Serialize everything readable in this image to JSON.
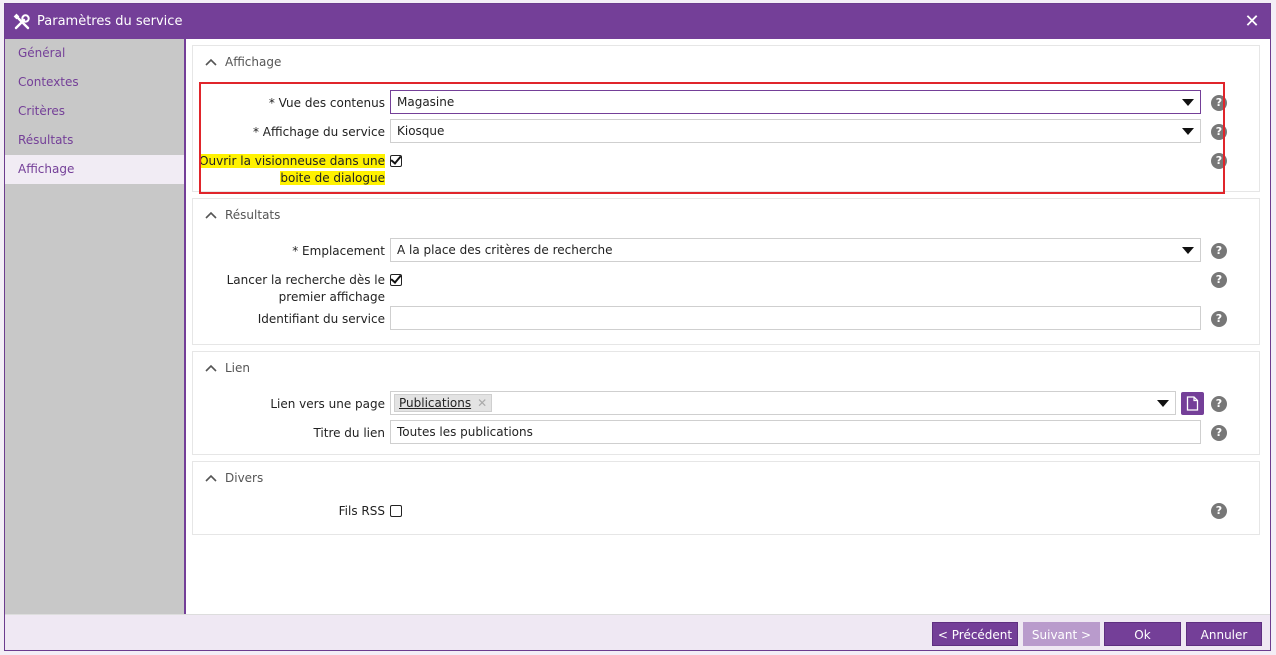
{
  "dialog": {
    "title": "Paramètres du service",
    "close": "✕"
  },
  "sidebar": {
    "items": [
      {
        "label": "Général"
      },
      {
        "label": "Contextes"
      },
      {
        "label": "Critères"
      },
      {
        "label": "Résultats"
      },
      {
        "label": "Affichage"
      }
    ],
    "active_index": 4
  },
  "sections": {
    "affichage": {
      "title": "Affichage",
      "vue_label": "* Vue des contenus",
      "vue_value": "Magasine",
      "affichage_label": "* Affichage du service",
      "affichage_value": "Kiosque",
      "visionneuse_label_1": "Ouvrir la visionneuse dans une",
      "visionneuse_label_2": "boite de dialogue",
      "visionneuse_checked": true
    },
    "resultats": {
      "title": "Résultats",
      "emplacement_label": "* Emplacement",
      "emplacement_value": "A la place des critères de recherche",
      "lancer_label_1": "Lancer la recherche dès le",
      "lancer_label_2": "premier affichage",
      "lancer_checked": true,
      "identifiant_label": "Identifiant du service",
      "identifiant_value": ""
    },
    "lien": {
      "title": "Lien",
      "page_label": "Lien vers une page",
      "page_tag": "Publications",
      "titre_label": "Titre du lien",
      "titre_value": "Toutes les publications"
    },
    "divers": {
      "title": "Divers",
      "rss_label": "Fils RSS",
      "rss_checked": false
    }
  },
  "help_glyph": "?",
  "footer": {
    "prev": "< Précédent",
    "next": "Suivant >",
    "ok": "Ok",
    "cancel": "Annuler"
  },
  "colors": {
    "accent": "#743f98",
    "highlight": "#fff200",
    "annotation_box": "#e0252b"
  }
}
